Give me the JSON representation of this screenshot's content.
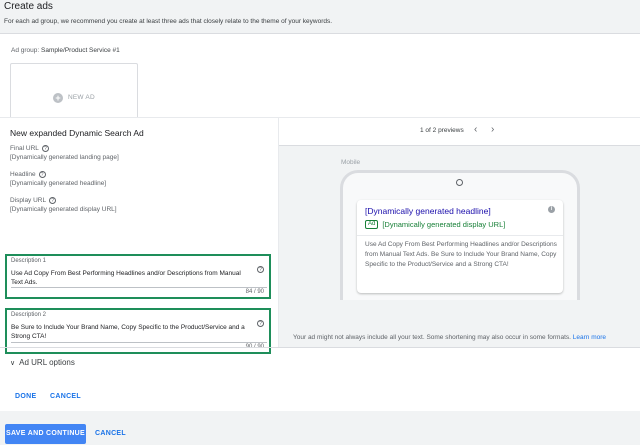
{
  "header": {
    "title": "Create ads",
    "description": "For each ad group, we recommend you create at least three ads that closely relate to the theme of your keywords."
  },
  "ad_group": {
    "label": "Ad group:",
    "name": "Sample/Product Service #1",
    "new_ad_label": "NEW AD"
  },
  "editor": {
    "heading": "New expanded Dynamic Search Ad",
    "fields": [
      {
        "label": "Final URL",
        "value": "[Dynamically generated landing page]"
      },
      {
        "label": "Headline",
        "value": "[Dynamically generated headline]"
      },
      {
        "label": "Display URL",
        "value": "[Dynamically generated display URL]"
      }
    ],
    "description1": {
      "label": "Description 1",
      "text": "Use Ad Copy From Best Performing Headlines and/or Descriptions from Manual Text Ads.",
      "count": "84 / 90"
    },
    "description2": {
      "label": "Description 2",
      "text": "Be Sure to Include Your Brand Name, Copy Specific to the Product/Service and a Strong CTA!",
      "count": "90 / 90"
    },
    "ad_url_options": "Ad URL options",
    "chevron": "∨"
  },
  "preview": {
    "counter": "1 of 2 previews",
    "prev_arrow": "‹",
    "next_arrow": "›",
    "device": "Mobile",
    "ad": {
      "headline": "[Dynamically generated headline]",
      "badge": "Ad",
      "display_url": "[Dynamically generated display URL]",
      "body": "Use Ad Copy From Best Performing Headlines and/or Descriptions from Manual Text Ads. Be Sure to Include Your Brand Name, Copy Specific to the Product/Service and a Strong CTA!"
    },
    "note": "Your ad might not always include all your text. Some shortening may also occur in some formats.",
    "learn_more": "Learn more"
  },
  "actions": {
    "done": "DONE",
    "cancel": "CANCEL",
    "save_continue": "SAVE AND CONTINUE",
    "bottom_cancel": "CANCEL"
  },
  "colors": {
    "highlight_border": "#1e8e5a",
    "primary_blue": "#4285f4",
    "link_blue": "#1a73e8",
    "ad_url_green": "#188038",
    "headline_blue": "#1a0dab"
  },
  "icons": {
    "plus": "+",
    "help": "?",
    "info": "i"
  }
}
